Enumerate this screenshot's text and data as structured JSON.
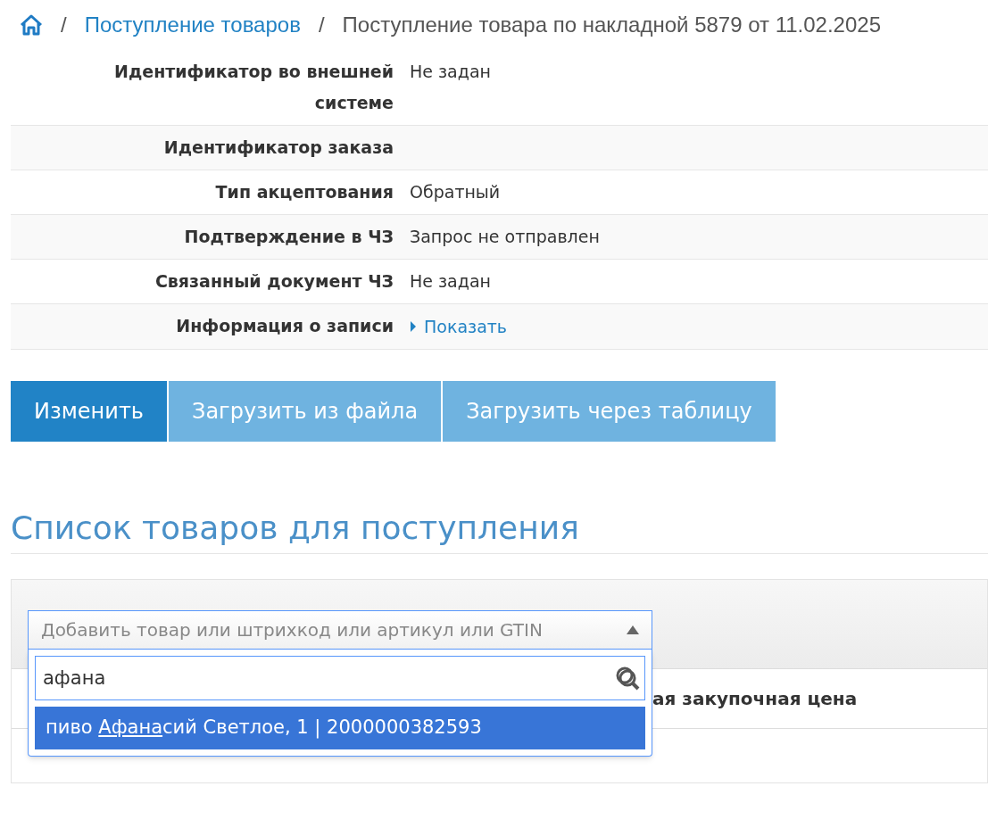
{
  "breadcrumb": [
    {
      "kind": "home"
    },
    {
      "kind": "separator",
      "label": "/"
    },
    {
      "kind": "link",
      "label": "Поступление товаров"
    },
    {
      "kind": "separator",
      "label": "/"
    },
    {
      "kind": "current",
      "label": "Поступление товара по накладной 5879 от 11.02.2025"
    }
  ],
  "details": [
    {
      "label": "Идентификатор во внешней системе",
      "value": "Не задан"
    },
    {
      "label": "Идентификатор заказа"
    },
    {
      "label": "Тип акцептования",
      "value": "Обратный"
    },
    {
      "label": "Подтверждение в ЧЗ",
      "value": "Запрос не отправлен"
    },
    {
      "label": "Связанный документ ЧЗ",
      "value": "Не задан"
    },
    {
      "label": "Информация о записи",
      "link": "Показать",
      "expanded": false
    }
  ],
  "buttons": [
    {
      "label": "Изменить",
      "kind": "primary"
    },
    {
      "label": "Загрузить из файла",
      "kind": "light"
    },
    {
      "label": "Загрузить через таблицу",
      "kind": "light"
    }
  ],
  "section_title": "Список товаров для поступления",
  "product_select": {
    "placeholder": "Добавить товар или штрихкод или артикул или GTIN",
    "expanded": true,
    "search": "афана",
    "options": [
      {
        "prefix": "пиво ",
        "match": "Афана",
        "suffix": "сий Светлое, 1 | 2000000382593",
        "selected": true
      }
    ]
  },
  "table": {
    "visible_header": "ая закупочная цена"
  }
}
